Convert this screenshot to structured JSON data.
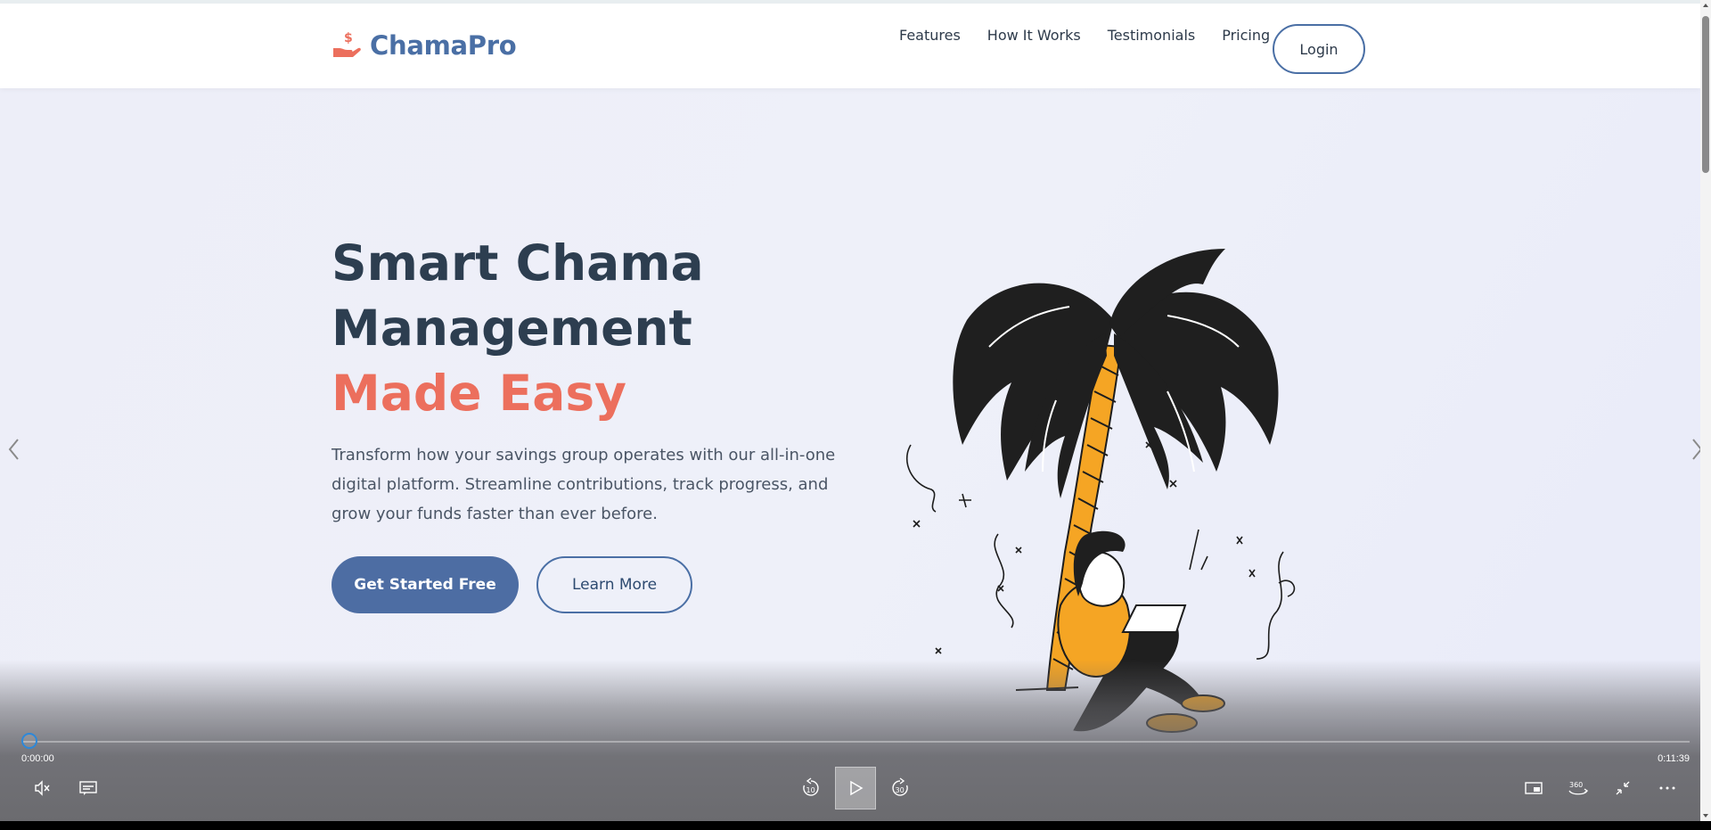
{
  "brand": {
    "name": "ChamaPro",
    "color": "#4a6fa5",
    "icon": "hand-dollar-icon"
  },
  "nav": {
    "links": [
      "Features",
      "How It Works",
      "Testimonials",
      "Pricing"
    ],
    "login_label": "Login"
  },
  "hero": {
    "title_part1": "Smart Chama Management",
    "title_accent": "Made Easy",
    "description": "Transform how your savings group operates with our all-in-one digital platform. Streamline contributions, track progress, and grow your funds faster than ever before.",
    "cta_primary": "Get Started Free",
    "cta_secondary": "Learn More",
    "accent_color": "#ec6f5d",
    "illustration": "woman-with-laptop-under-palm-tree-illustration"
  },
  "player": {
    "current_time": "0:00:00",
    "total_time": "0:11:39",
    "progress": 0,
    "controls": {
      "mute": "mute-icon",
      "captions": "captions-icon",
      "rewind": "rewind-10-icon",
      "play": "play-icon",
      "forward": "forward-30-icon",
      "miniplayer": "miniplayer-icon",
      "view360": "360-icon",
      "exit_fullscreen": "exit-fullscreen-icon",
      "more": "more-options-icon"
    },
    "rewind_label": "10",
    "forward_label": "30",
    "view360_label": "360"
  }
}
